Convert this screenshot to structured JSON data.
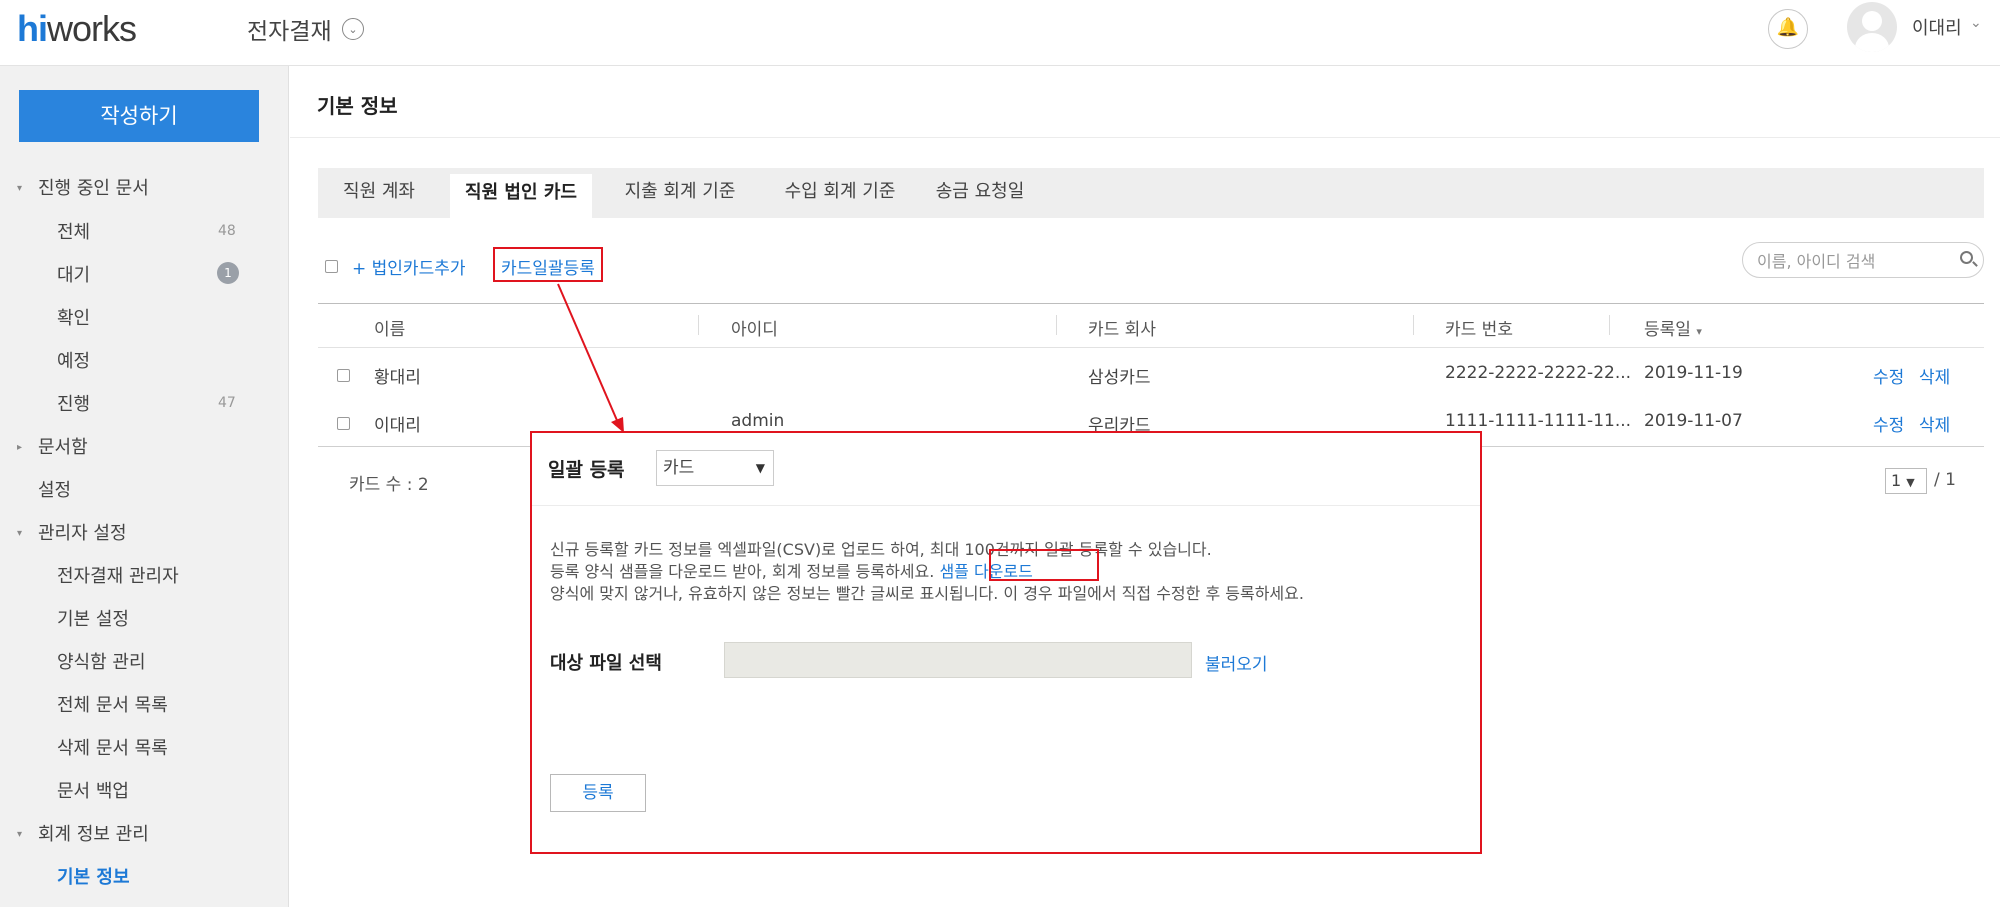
{
  "header": {
    "logo_hi": "hi",
    "logo_rest": "works",
    "app_title": "전자결재",
    "user_name": "이대리"
  },
  "sidebar": {
    "write_button": "작성하기",
    "sections": {
      "in_progress": "진행 중인 문서",
      "all": "전체",
      "all_count": "48",
      "pending": "대기",
      "pending_count": "1",
      "confirm": "확인",
      "scheduled": "예정",
      "progress": "진행",
      "progress_count": "47",
      "archive": "문서함",
      "settings": "설정",
      "admin_settings": "관리자 설정",
      "approval_admin": "전자결재 관리자",
      "basic_settings": "기본 설정",
      "form_mgmt": "양식함 관리",
      "all_docs": "전체 문서 목록",
      "deleted_docs": "삭제 문서 목록",
      "doc_backup": "문서 백업",
      "accounting_mgmt": "회계 정보 관리",
      "basic_info": "기본 정보"
    }
  },
  "main": {
    "title": "기본 정보",
    "tabs": [
      "직원 계좌",
      "직원 법인 카드",
      "지출 회계 기준",
      "수입 회계 기준",
      "송금 요청일"
    ],
    "add_card": "+ 법인카드추가",
    "bulk_register": "카드일괄등록",
    "search_placeholder": "이름, 아이디 검색",
    "columns": [
      "이름",
      "아이디",
      "카드 회사",
      "카드 번호",
      "등록일"
    ],
    "rows": [
      {
        "name": "황대리",
        "id": "",
        "company": "삼성카드",
        "card": "2222-2222-2222-22...",
        "date": "2019-11-19",
        "edit": "수정",
        "delete": "삭제"
      },
      {
        "name": "이대리",
        "id": "admin",
        "company": "우리카드",
        "card": "1111-1111-1111-11...",
        "date": "2019-11-07",
        "edit": "수정",
        "delete": "삭제"
      }
    ],
    "card_count": "카드 수 : 2",
    "page_current": "1",
    "page_total": "/ 1"
  },
  "modal": {
    "title": "일괄 등록",
    "select_value": "카드",
    "line1": "신규 등록할 카드 정보를 엑셀파일(CSV)로 업로드 하여, 최대 100건까지 일괄 등록할 수 있습니다.",
    "line2": "등록 양식 샘플을 다운로드 받아, 회계 정보를 등록하세요.",
    "sample_download": "샘플 다운로드",
    "line3": "양식에 맞지 않거나, 유효하지 않은 정보는 빨간 글씨로 표시됩니다. 이 경우 파일에서 직접 수정한 후 등록하세요.",
    "file_label": "대상 파일 선택",
    "load_button": "불러오기",
    "submit_button": "등록"
  },
  "colors": {
    "accent": "#2a84dd",
    "link": "#1d79d6",
    "annotation": "#e0141e"
  }
}
